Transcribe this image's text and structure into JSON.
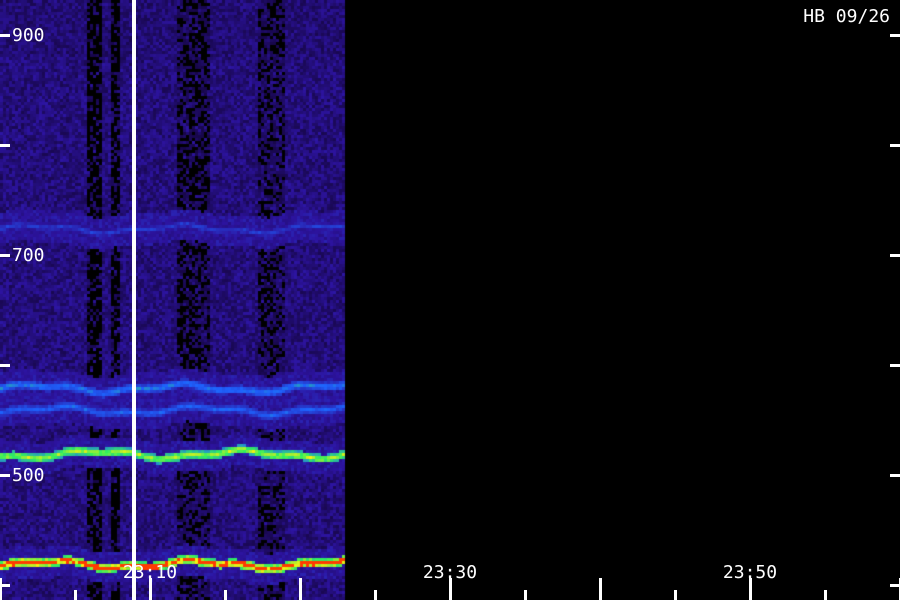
{
  "station_label": "HB 09/26",
  "chart_data": {
    "type": "heatmap",
    "title": "",
    "xlabel": "",
    "ylabel": "",
    "y_ticks": [
      "900",
      "700",
      "500"
    ],
    "x_ticks": [
      "23:10",
      "23:30",
      "23:50"
    ],
    "ylim": [
      400,
      950
    ],
    "x_range": [
      "23:01",
      "24:00"
    ],
    "data_end": "23:23",
    "grid": false,
    "colors": {
      "background": "#000000",
      "low": "#2a0f8c",
      "mid": "#1e6cff",
      "high": "#3cff4a",
      "peak": "#ff2a00"
    },
    "bands": [
      {
        "freq": 725,
        "level": 0.45
      },
      {
        "freq": 580,
        "level": 0.6
      },
      {
        "freq": 560,
        "level": 0.55
      },
      {
        "freq": 520,
        "level": 0.85
      },
      {
        "freq": 420,
        "level": 0.95
      }
    ]
  }
}
